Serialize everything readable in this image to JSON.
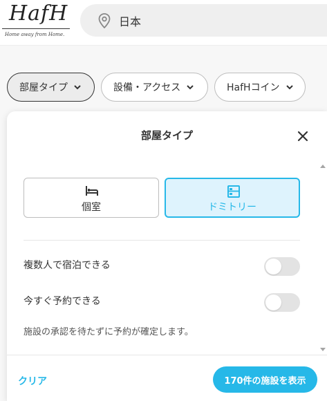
{
  "header": {
    "logo_text": "HafH",
    "logo_tagline": "Home away from Home.",
    "search": {
      "value": "日本",
      "icon": "location-pin-icon"
    }
  },
  "filters": [
    {
      "label": "部屋タイプ",
      "active": true
    },
    {
      "label": "設備・アクセス",
      "active": false
    },
    {
      "label": "HafHコイン",
      "active": false
    }
  ],
  "panel": {
    "title": "部屋タイプ",
    "room_types": [
      {
        "label": "個室",
        "icon": "bed-icon",
        "selected": false
      },
      {
        "label": "ドミトリー",
        "icon": "bunk-bed-icon",
        "selected": true
      }
    ],
    "options": [
      {
        "label": "複数人で宿泊できる",
        "on": false
      },
      {
        "label": "今すぐ予約できる",
        "on": false
      }
    ],
    "note": "施設の承認を待たずに予約が確定します。",
    "footer": {
      "clear_label": "クリア",
      "show_button_label": "170件の施設を表示"
    }
  },
  "colors": {
    "accent": "#26b8e8",
    "selected_bg": "#def3fd",
    "toggle_off": "#e3e3e3"
  }
}
